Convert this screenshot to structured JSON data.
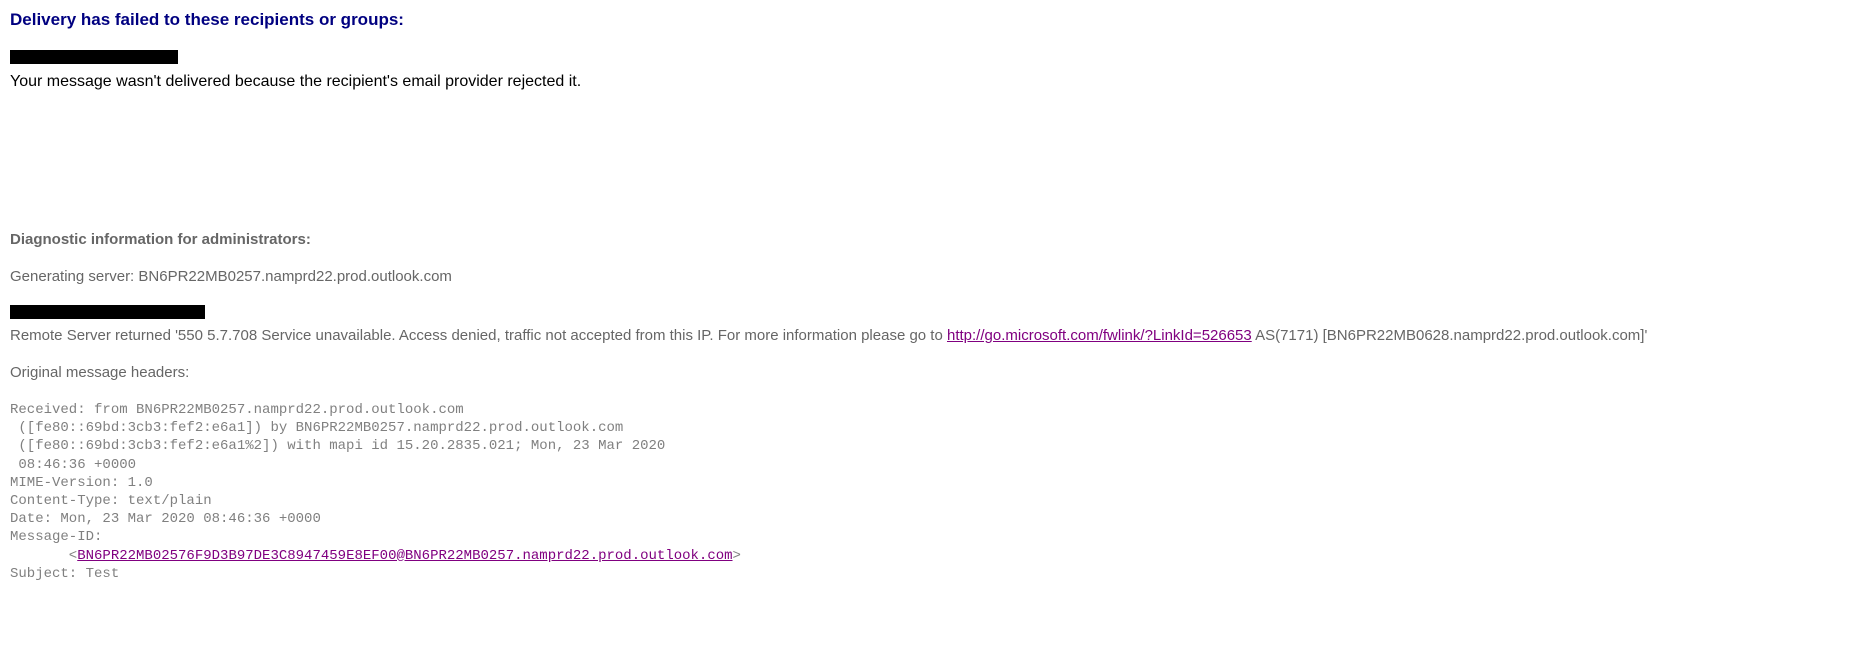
{
  "heading": "Delivery has failed to these recipients or groups:",
  "rejection_text": "Your message wasn't delivered because the recipient's email provider rejected it.",
  "diag_heading": "Diagnostic information for administrators:",
  "gen_server_label": "Generating server: BN6PR22MB0257.namprd22.prod.outlook.com",
  "remote_prefix": "Remote Server returned '550 5.7.708 Service unavailable. Access denied, traffic not accepted from this IP. For more information please go to ",
  "remote_link": "http://go.microsoft.com/fwlink/?LinkId=526653",
  "remote_suffix": " AS(7171) [BN6PR22MB0628.namprd22.prod.outlook.com]'",
  "orig_headers_label": "Original message headers:",
  "headers": {
    "line1": "Received: from BN6PR22MB0257.namprd22.prod.outlook.com",
    "line2": " ([fe80::69bd:3cb3:fef2:e6a1]) by BN6PR22MB0257.namprd22.prod.outlook.com",
    "line3": " ([fe80::69bd:3cb3:fef2:e6a1%2]) with mapi id 15.20.2835.021; Mon, 23 Mar 2020",
    "line4": " 08:46:36 +0000",
    "line5": "MIME-Version: 1.0",
    "line6": "Content-Type: text/plain",
    "line7": "Date: Mon, 23 Mar 2020 08:46:36 +0000",
    "line8": "Message-ID:",
    "line9_prefix": "       <",
    "line9_link": "BN6PR22MB02576F9D3B97DE3C8947459E8EF00@BN6PR22MB0257.namprd22.prod.outlook.com",
    "line9_suffix": ">",
    "line10": "Subject: Test"
  }
}
